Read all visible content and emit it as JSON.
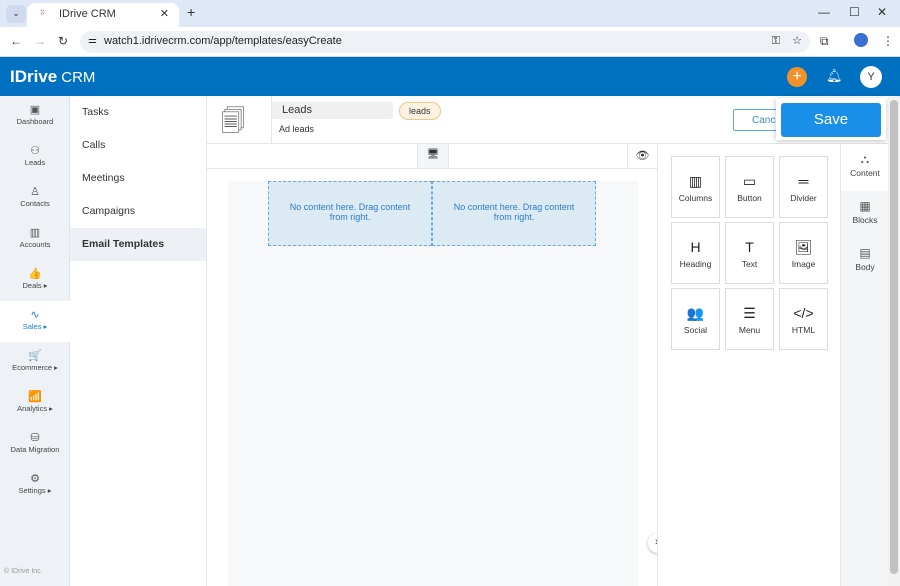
{
  "browser": {
    "tab_title": "IDrive CRM",
    "url": "watch1.idrivecrm.com/app/templates/easyCreate"
  },
  "app": {
    "brand": "IDrive",
    "brand_suffix": "CRM",
    "avatar": "Y",
    "accent": "#0070c0",
    "add_color": "#f0912a"
  },
  "nav": [
    {
      "label": "Dashboard",
      "icon": "▣"
    },
    {
      "label": "Leads",
      "icon": "⚇"
    },
    {
      "label": "Contacts",
      "icon": "♙"
    },
    {
      "label": "Accounts",
      "icon": "▥"
    },
    {
      "label": "Deals ▸",
      "icon": "👍"
    },
    {
      "label": "Sales ▸",
      "icon": "∿"
    },
    {
      "label": "Ecommerce ▸",
      "icon": "🛒"
    },
    {
      "label": "Analytics ▸",
      "icon": "📶"
    },
    {
      "label": "Data Migration",
      "icon": "⛁"
    },
    {
      "label": "Settings ▸",
      "icon": "⚙"
    }
  ],
  "subnav": [
    "Tasks",
    "Calls",
    "Meetings",
    "Campaigns",
    "Email Templates"
  ],
  "footer": "© IDrive Inc.",
  "template": {
    "name": "Leads",
    "tag": "leads",
    "description": "Ad leads"
  },
  "buttons": {
    "cancel": "Cancel",
    "save": "Save"
  },
  "canvas": {
    "placeholder": "No content here. Drag content from right."
  },
  "tiles": [
    {
      "label": "Columns",
      "icon": "▥"
    },
    {
      "label": "Button",
      "icon": "▭"
    },
    {
      "label": "Divider",
      "icon": "═"
    },
    {
      "label": "Heading",
      "icon": "H"
    },
    {
      "label": "Text",
      "icon": "T"
    },
    {
      "label": "Image",
      "icon": "🖼"
    },
    {
      "label": "Social",
      "icon": "👥"
    },
    {
      "label": "Menu",
      "icon": "☰"
    },
    {
      "label": "HTML",
      "icon": "</>"
    }
  ],
  "right_tabs": [
    {
      "label": "Content",
      "icon": "⛬"
    },
    {
      "label": "Blocks",
      "icon": "▦"
    },
    {
      "label": "Body",
      "icon": "▤"
    }
  ]
}
